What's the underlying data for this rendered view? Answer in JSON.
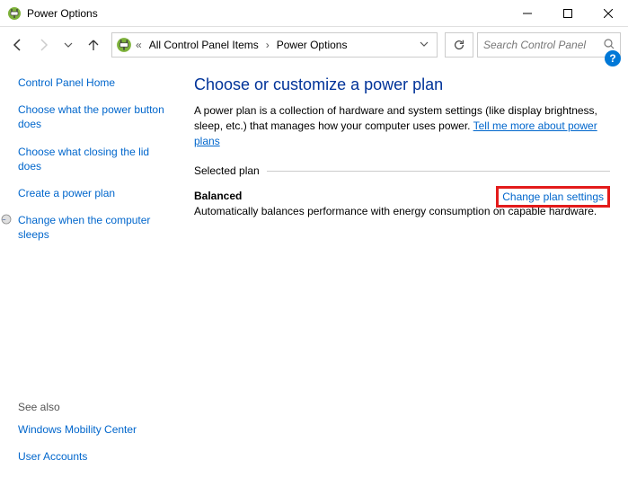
{
  "window": {
    "title": "Power Options"
  },
  "breadcrumb": {
    "segments": [
      "All Control Panel Items",
      "Power Options"
    ]
  },
  "search": {
    "placeholder": "Search Control Panel"
  },
  "sidebar": {
    "home": "Control Panel Home",
    "links": [
      "Choose what the power button does",
      "Choose what closing the lid does",
      "Create a power plan",
      "Change when the computer sleeps"
    ]
  },
  "seeAlso": {
    "heading": "See also",
    "links": [
      "Windows Mobility Center",
      "User Accounts"
    ]
  },
  "main": {
    "heading": "Choose or customize a power plan",
    "introText": "A power plan is a collection of hardware and system settings (like display brightness, sleep, etc.) that manages how your computer uses power. ",
    "introLink": "Tell me more about power plans",
    "sectionLabel": "Selected plan",
    "plan": {
      "name": "Balanced",
      "changeLink": "Change plan settings",
      "description": "Automatically balances performance with energy consumption on capable hardware."
    }
  }
}
